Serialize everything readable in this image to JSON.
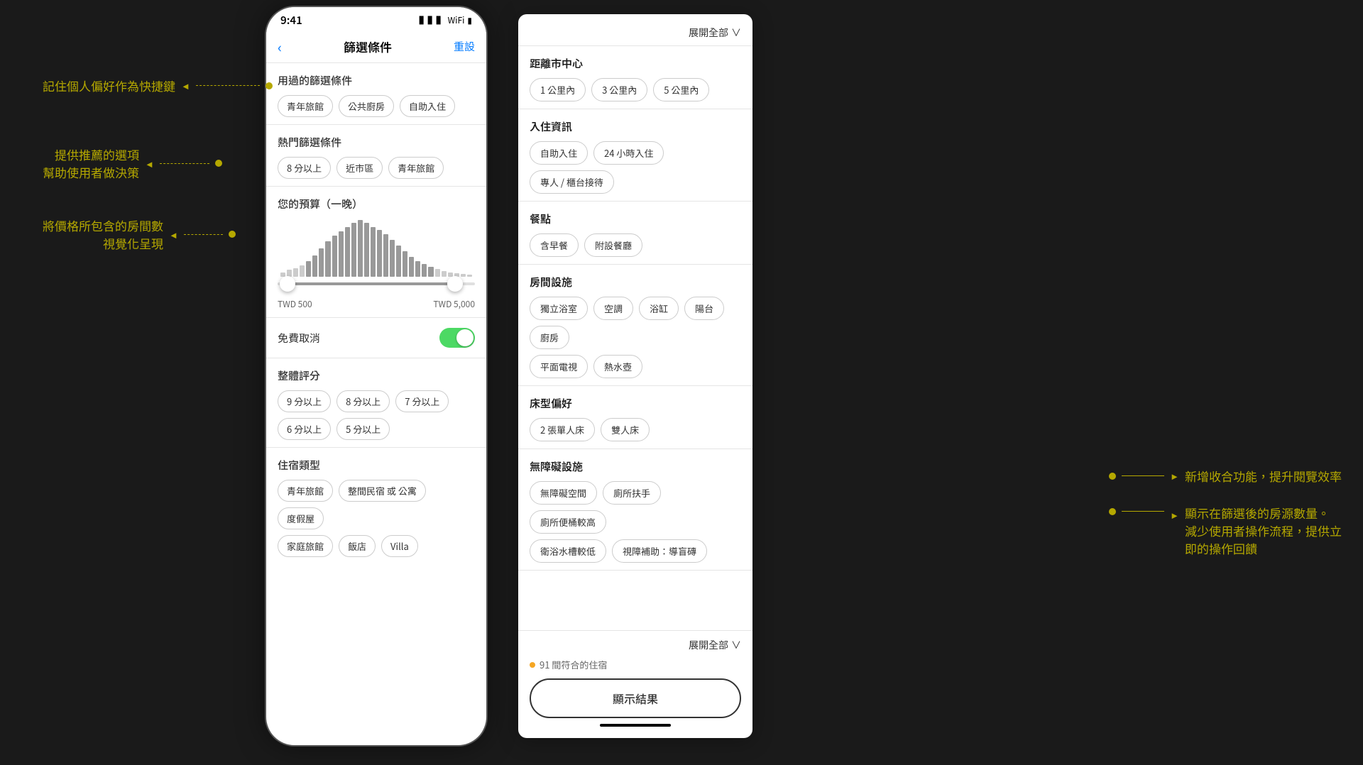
{
  "phone": {
    "statusBar": {
      "time": "9:41",
      "signal": "▌▌▌",
      "wifi": "WiFi",
      "battery": "🔋"
    },
    "header": {
      "backIcon": "‹",
      "title": "篩選條件",
      "reset": "重設"
    },
    "sections": {
      "usedFilters": {
        "title": "用過的篩選條件",
        "tags": [
          "青年旅館",
          "公共廚房",
          "自助入住"
        ]
      },
      "popularFilters": {
        "title": "熱門篩選條件",
        "tags": [
          "8 分以上",
          "近市區",
          "青年旅館"
        ]
      },
      "budget": {
        "title": "您的預算（一晚）",
        "minLabel": "TWD 500",
        "maxLabel": "TWD 5,000"
      },
      "freeCancellation": {
        "label": "免費取消"
      },
      "rating": {
        "title": "整體評分",
        "tags": [
          "9 分以上",
          "8 分以上",
          "7 分以上",
          "6 分以上",
          "5 分以上"
        ]
      },
      "accommodationType": {
        "title": "住宿類型",
        "tags": [
          "青年旅館",
          "整間民宿 或 公寓",
          "度假屋",
          "家庭旅館",
          "飯店",
          "Villa"
        ]
      }
    }
  },
  "rightPanel": {
    "expandAll": "展開全部",
    "expandAllIcon": "∨",
    "sections": {
      "distanceFromCenter": {
        "title": "距離市中心",
        "tags": [
          "1 公里內",
          "3 公里內",
          "5 公里內"
        ]
      },
      "checkIn": {
        "title": "入住資訊",
        "tags": [
          "自助入住",
          "24 小時入住",
          "專人 / 櫃台接待"
        ]
      },
      "meals": {
        "title": "餐點",
        "tags": [
          "含早餐",
          "附設餐廳"
        ]
      },
      "roomFacilities": {
        "title": "房間設施",
        "tags": [
          "獨立浴室",
          "空調",
          "浴缸",
          "陽台",
          "廚房",
          "平面電視",
          "熱水壺"
        ]
      },
      "bedPreference": {
        "title": "床型偏好",
        "tags": [
          "2 張單人床",
          "雙人床"
        ]
      },
      "accessibility": {
        "title": "無障礙設施",
        "tags": [
          "無障礙空間",
          "廁所扶手",
          "廁所便桶較高",
          "衛浴水槽較低",
          "視障補助：導盲磚"
        ]
      }
    },
    "footer": {
      "expandAll": "展開全部",
      "expandAllIcon": "∨",
      "resultCount": "91 間符合的住宿",
      "showResults": "顯示結果"
    }
  },
  "annotations": {
    "left1": "記住個人偏好作為快捷鍵",
    "left2line1": "提供推薦的選項",
    "left2line2": "幫助使用者做決策",
    "left3line1": "將價格所包含的房間數",
    "left3line2": "視覺化呈現",
    "right1": "新增收合功能，提升閱覽效率",
    "right2line1": "顯示在篩選後的房源數量。",
    "right2line2": "減少使用者操作流程，提供立",
    "right2line3": "即的操作回饋"
  }
}
